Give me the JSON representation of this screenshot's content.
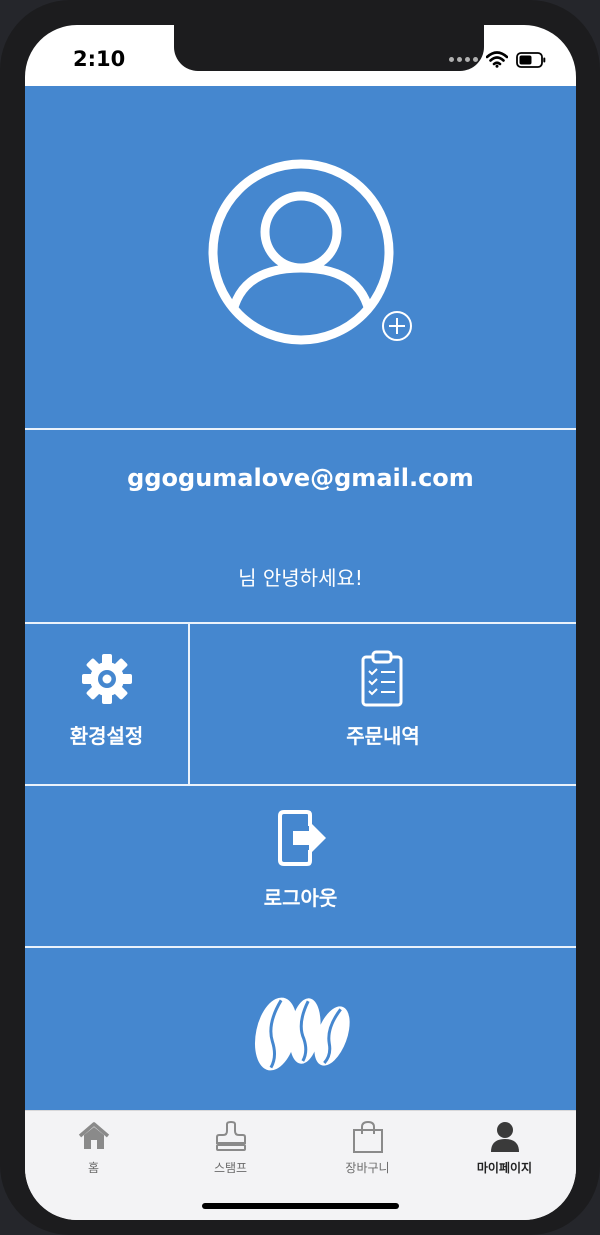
{
  "status_bar": {
    "time": "2:10"
  },
  "profile": {
    "email": "ggogumalove@gmail.com",
    "greeting": "님 안녕하세요!"
  },
  "menu": {
    "settings_label": "환경설정",
    "orders_label": "주문내역",
    "logout_label": "로그아웃"
  },
  "tabbar": {
    "items": [
      {
        "label": "홈",
        "icon": "home-icon"
      },
      {
        "label": "스탬프",
        "icon": "stamp-icon"
      },
      {
        "label": "장바구니",
        "icon": "shopping-bag-icon"
      },
      {
        "label": "마이페이지",
        "icon": "person-icon"
      }
    ],
    "active": "마이페이지"
  },
  "colors": {
    "primary": "#4587cf",
    "divider": "#eaf2fb",
    "tabbar_bg": "#f3f3f5"
  }
}
